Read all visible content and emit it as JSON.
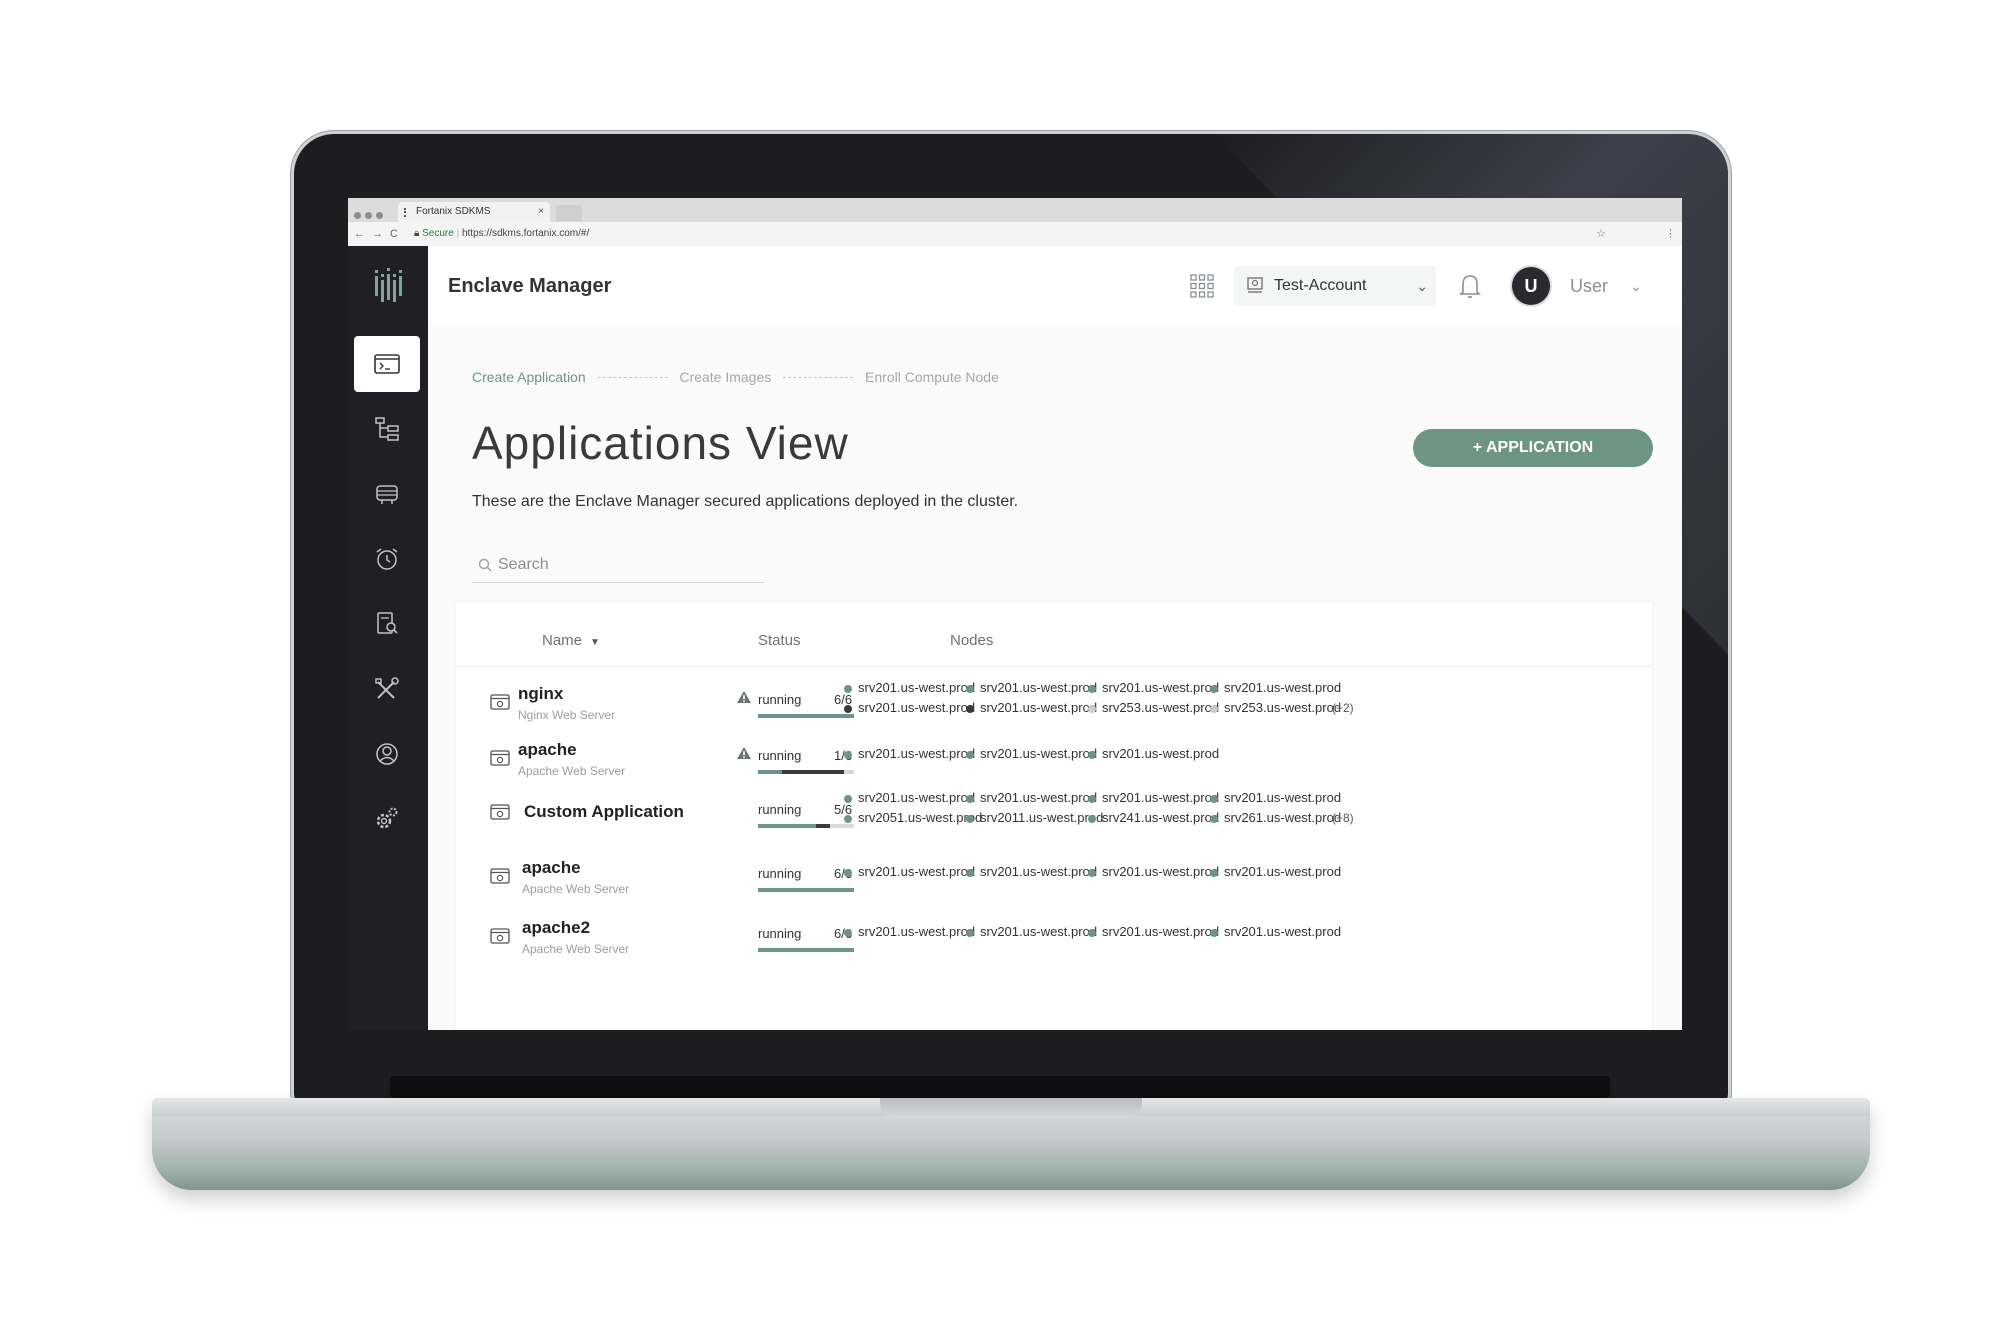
{
  "browser": {
    "tab_title": "Fortanix SDKMS",
    "tab_close": "×",
    "secure_label": "Secure",
    "url": "https://sdkms.fortanix.com/#/",
    "back": "←",
    "forward": "→",
    "reload": "C",
    "star": "☆",
    "more": "⋮"
  },
  "header": {
    "title": "Enclave Manager",
    "account": "Test-Account",
    "avatar_letter": "U",
    "user": "User"
  },
  "steps": [
    "Create Application",
    "Create Images",
    "Enroll Compute Node"
  ],
  "page": {
    "title": "Applications View",
    "description": "These are the Enclave Manager secured applications deployed in the cluster.",
    "add_button": "+ APPLICATION",
    "search_placeholder": "Search"
  },
  "table": {
    "columns": [
      "Name",
      "Status",
      "Nodes"
    ],
    "rows": [
      {
        "name": "nginx",
        "subtitle": "Nginx Web Server",
        "warning": true,
        "status": "running",
        "count": "6/6",
        "progress": 1.0,
        "nodes": [
          {
            "label": "srv201.us-west.prod",
            "state": "green"
          },
          {
            "label": "srv201.us-west.prod",
            "state": "green"
          },
          {
            "label": "srv201.us-west.prod",
            "state": "green"
          },
          {
            "label": "srv201.us-west.prod",
            "state": "green"
          },
          {
            "label": "srv201.us-west.prod",
            "state": "dark"
          },
          {
            "label": "srv201.us-west.prod",
            "state": "dark"
          },
          {
            "label": "srv253.us-west.prod",
            "state": "light"
          },
          {
            "label": "srv253.us-west.prod",
            "state": "light"
          }
        ],
        "more": "(+2)"
      },
      {
        "name": "apache",
        "subtitle": "Apache Web Server",
        "warning": true,
        "status": "running",
        "count": "1/6",
        "progress": 0.25,
        "nodes": [
          {
            "label": "srv201.us-west.prod",
            "state": "green"
          },
          {
            "label": "srv201.us-west.prod",
            "state": "green"
          },
          {
            "label": "srv201.us-west.prod",
            "state": "green"
          }
        ],
        "more": ""
      },
      {
        "name": "Custom Application",
        "subtitle": "",
        "warning": false,
        "status": "running",
        "count": "5/6",
        "progress": 0.6,
        "nodes": [
          {
            "label": "srv201.us-west.prod",
            "state": "green"
          },
          {
            "label": "srv201.us-west.prod",
            "state": "green"
          },
          {
            "label": "srv201.us-west.prod",
            "state": "green"
          },
          {
            "label": "srv201.us-west.prod",
            "state": "green"
          },
          {
            "label": "srv2051.us-west.prod",
            "state": "green"
          },
          {
            "label": "srv2011.us-west.prod",
            "state": "green"
          },
          {
            "label": "srv241.us-west.prod",
            "state": "green"
          },
          {
            "label": "srv261.us-west.prod",
            "state": "green"
          }
        ],
        "more": "(+8)"
      },
      {
        "name": "apache",
        "subtitle": "Apache Web Server",
        "warning": false,
        "status": "running",
        "count": "6/6",
        "progress": 1.0,
        "nodes": [
          {
            "label": "srv201.us-west.prod",
            "state": "green"
          },
          {
            "label": "srv201.us-west.prod",
            "state": "green"
          },
          {
            "label": "srv201.us-west.prod",
            "state": "green"
          },
          {
            "label": "srv201.us-west.prod",
            "state": "green"
          }
        ],
        "more": ""
      },
      {
        "name": "apache2",
        "subtitle": "Apache Web Server",
        "warning": false,
        "status": "running",
        "count": "6/6",
        "progress": 1.0,
        "nodes": [
          {
            "label": "srv201.us-west.prod",
            "state": "green"
          },
          {
            "label": "srv201.us-west.prod",
            "state": "green"
          },
          {
            "label": "srv201.us-west.prod",
            "state": "green"
          },
          {
            "label": "srv201.us-west.prod",
            "state": "green"
          }
        ],
        "more": ""
      }
    ]
  },
  "colors": {
    "accent": "#6e9484",
    "sidebar": "#1f1f24",
    "node_green": "#6e9484",
    "node_dark": "#3a3a40",
    "node_light": "#c9cccc"
  },
  "sidebar_icons": [
    "terminal-icon",
    "hierarchy-icon",
    "server-icon",
    "alarm-clock-icon",
    "certificate-search-icon",
    "tools-icon",
    "user-circle-icon",
    "settings-gears-icon"
  ]
}
